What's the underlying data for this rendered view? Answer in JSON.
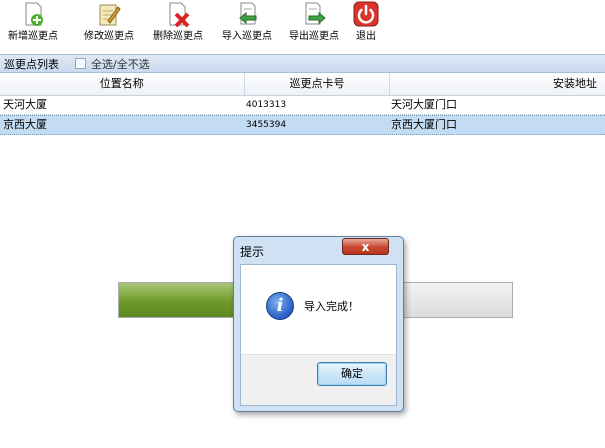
{
  "toolbar": {
    "buttons": [
      {
        "label": "新增巡更点",
        "icon": "add-file-icon"
      },
      {
        "label": "修改巡更点",
        "icon": "edit-notepad-icon"
      },
      {
        "label": "删除巡更点",
        "icon": "delete-file-icon"
      },
      {
        "label": "导入巡更点",
        "icon": "import-icon"
      },
      {
        "label": "导出巡更点",
        "icon": "export-icon"
      },
      {
        "label": "退出",
        "icon": "power-icon"
      }
    ]
  },
  "list": {
    "title": "巡更点列表",
    "select_all_label": "全选/全不选"
  },
  "table": {
    "columns": [
      "位置名称",
      "巡更点卡号",
      "安装地址"
    ],
    "rows": [
      [
        "天河大厦",
        "4013313",
        "天河大厦门口"
      ],
      [
        "京西大厦",
        "3455394",
        "京西大厦门口"
      ]
    ]
  },
  "progress": {
    "value": 0.3
  },
  "dialog": {
    "title": "提示",
    "close_label": "x",
    "message": "导入完成！",
    "ok_label": "确定"
  },
  "colors": {
    "selected_row": "#c4dcf3",
    "progress_fill": "#6f9a2a",
    "close_button": "#c8462f"
  }
}
